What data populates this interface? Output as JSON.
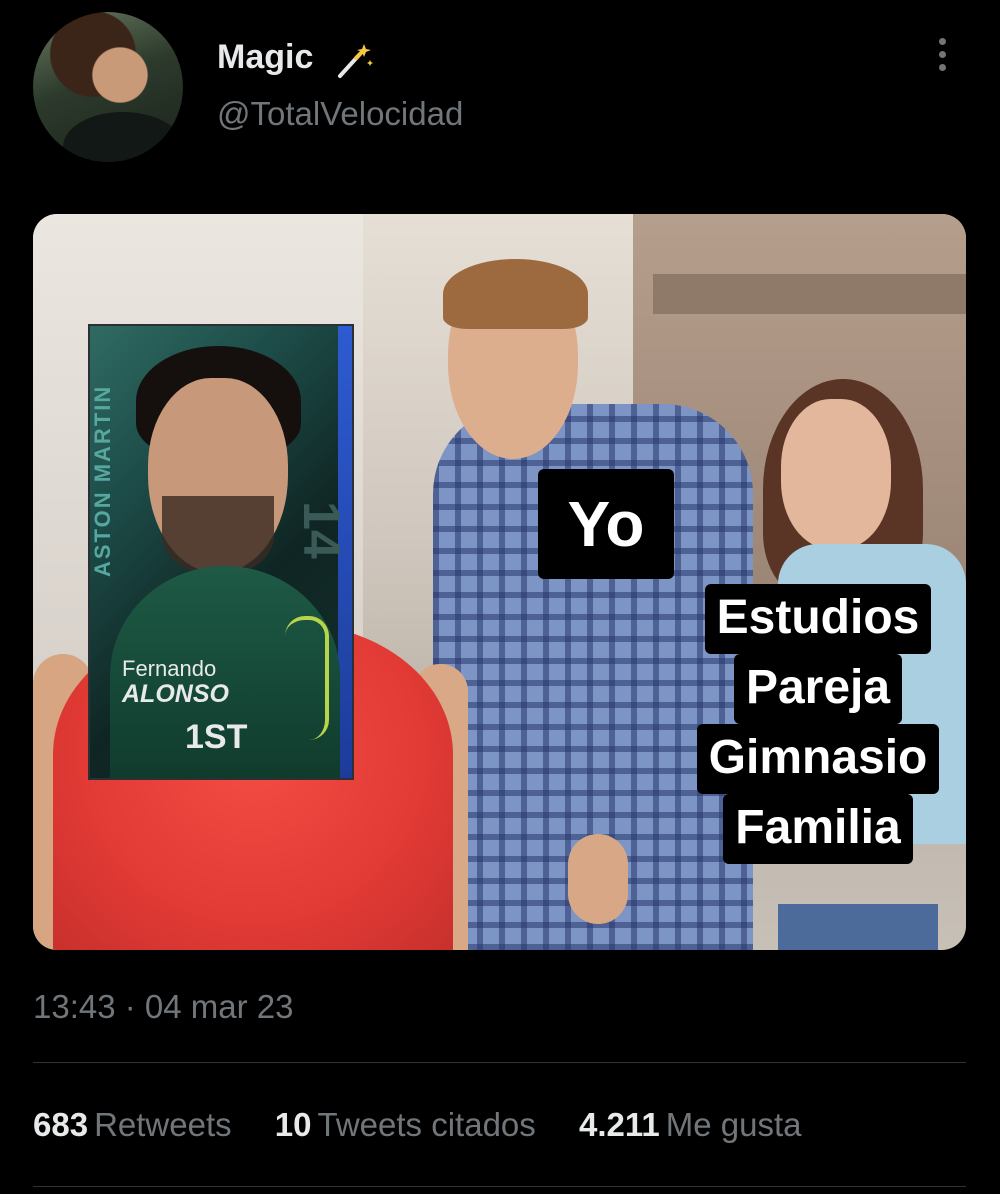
{
  "tweet": {
    "author": {
      "display_name": "Magic",
      "handle": "@TotalVelocidad",
      "badge_icon": "magic-wand-icon"
    },
    "timestamp": "13:43 · 04 mar 23",
    "stats": [
      {
        "count": "683",
        "label": "Retweets"
      },
      {
        "count": "10",
        "label": "Tweets citados"
      },
      {
        "count": "4.211",
        "label": "Me gusta"
      }
    ],
    "more_icon": "more-dots-vertical-icon"
  },
  "meme": {
    "label_yo": "Yo",
    "labels_girlfriend": [
      "Estudios",
      "Pareja",
      "Gimnasio",
      "Familia"
    ],
    "card": {
      "team": "ASTON MARTIN",
      "number": "14",
      "first_name": "Fernando",
      "last_name": "ALONSO",
      "rank": "1ST"
    }
  },
  "colors": {
    "background": "#000000",
    "text_primary": "#e7e9ea",
    "text_secondary": "#71767b",
    "divider": "#2f3336"
  }
}
